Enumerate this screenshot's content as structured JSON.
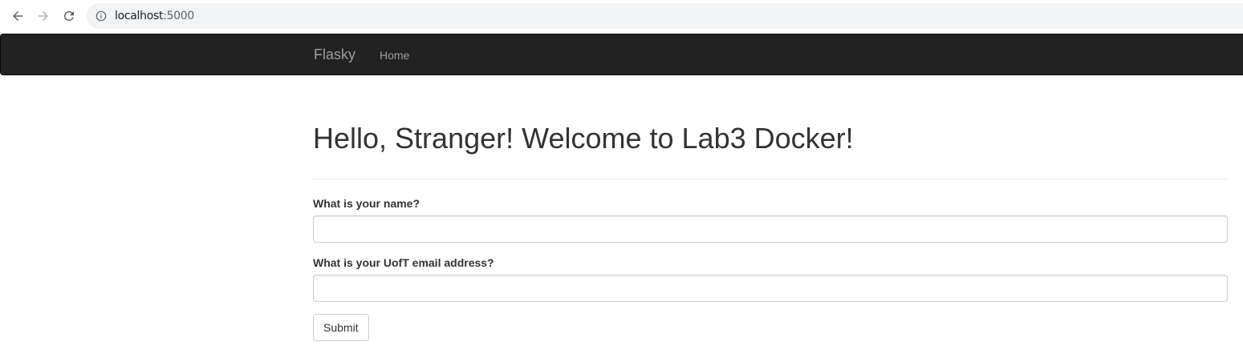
{
  "browser": {
    "url_host": "localhost",
    "url_port": ":5000"
  },
  "navbar": {
    "brand": "Flasky",
    "home": "Home"
  },
  "main": {
    "heading": "Hello, Stranger! Welcome to Lab3 Docker!",
    "form": {
      "name_label": "What is your name?",
      "name_value": "",
      "email_label": "What is your UofT email address?",
      "email_value": "",
      "submit_label": "Submit"
    }
  },
  "colors": {
    "navbar_bg": "#222222",
    "nav_text": "#9d9d9d",
    "text": "#333333"
  }
}
